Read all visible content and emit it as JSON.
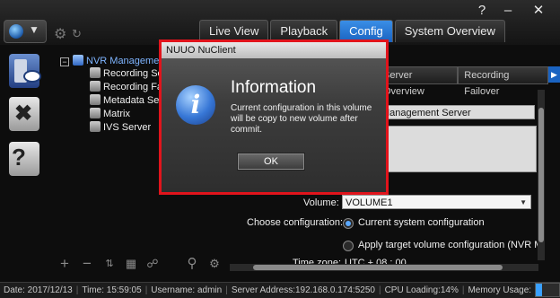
{
  "window": {
    "help": "?",
    "minimize": "–",
    "close": "✕"
  },
  "tabs": [
    {
      "label": "Live View"
    },
    {
      "label": "Playback"
    },
    {
      "label": "Config"
    },
    {
      "label": "System Overview"
    }
  ],
  "active_tab": "Config",
  "tree": {
    "root": "NVR Management",
    "items": [
      "Recording Se",
      "Recording Fa",
      "Metadata Ser",
      "Matrix",
      "IVS Server"
    ]
  },
  "subtabs": [
    "Server Overview",
    "Recording Failover"
  ],
  "settings": {
    "name_value": "Management Server",
    "volume_label": "Volume:",
    "volume_value": "VOLUME1",
    "choose_label": "Choose configuration:",
    "option1": "Current system configuration",
    "option2": "Apply target volume configuration (NVR Mana",
    "timezone_label": "Time zone:",
    "timezone_value": "UTC + 08 : 00"
  },
  "dialog": {
    "title": "NUUO NuClient",
    "heading": "Information",
    "message": "Current configuration in this volume will be copy to new volume after commit.",
    "ok": "OK",
    "icon": "info-icon"
  },
  "status": {
    "date": "Date: 2017/12/13",
    "time": "Time: 15:59:05",
    "username": "Username: admin",
    "server": "Server Address:192.168.0.174:5250",
    "cpu": "CPU Loading:14%",
    "memory": "Memory Usage:"
  },
  "colors": {
    "accent": "#1a63c1",
    "highlight": "#e1141c"
  }
}
